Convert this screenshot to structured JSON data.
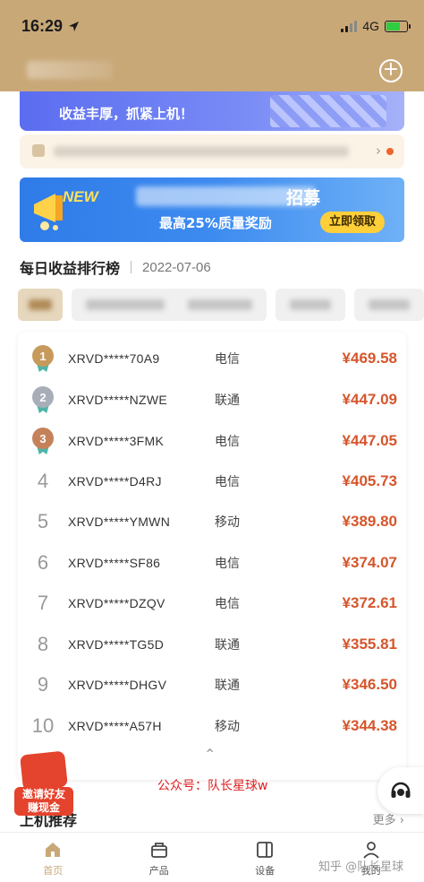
{
  "status_bar": {
    "time": "16:29",
    "network": "4G"
  },
  "header": {
    "add_icon": "plus-circle-icon"
  },
  "banner_top": {
    "slogan": "收益丰厚，抓紧上机！"
  },
  "notice": {
    "chevron": "›"
  },
  "banner_promo": {
    "tag": "NEW",
    "title_suffix": "招募",
    "reward_text": "最高25%质量奖励",
    "cta": "立即领取"
  },
  "ranking": {
    "title": "每日收益排行榜",
    "date": "2022-07-06",
    "rows": [
      {
        "rank": "1",
        "code": "XRVD*****70A9",
        "carrier": "电信",
        "amount": "¥469.58"
      },
      {
        "rank": "2",
        "code": "XRVD*****NZWE",
        "carrier": "联通",
        "amount": "¥447.09"
      },
      {
        "rank": "3",
        "code": "XRVD*****3FMK",
        "carrier": "电信",
        "amount": "¥447.05"
      },
      {
        "rank": "4",
        "code": "XRVD*****D4RJ",
        "carrier": "电信",
        "amount": "¥405.73"
      },
      {
        "rank": "5",
        "code": "XRVD*****YMWN",
        "carrier": "移动",
        "amount": "¥389.80"
      },
      {
        "rank": "6",
        "code": "XRVD*****SF86",
        "carrier": "电信",
        "amount": "¥374.07"
      },
      {
        "rank": "7",
        "code": "XRVD*****DZQV",
        "carrier": "电信",
        "amount": "¥372.61"
      },
      {
        "rank": "8",
        "code": "XRVD*****TG5D",
        "carrier": "联通",
        "amount": "¥355.81"
      },
      {
        "rank": "9",
        "code": "XRVD*****DHGV",
        "carrier": "联通",
        "amount": "¥346.50"
      },
      {
        "rank": "10",
        "code": "XRVD*****A57H",
        "carrier": "移动",
        "amount": "¥344.38"
      }
    ],
    "collapse": "⌃"
  },
  "overlay": {
    "public_account": "公众号：队长星球w",
    "invite_line1": "邀请好友",
    "invite_line2": "赚现金",
    "recommend_title": "上机推荐",
    "more": "更多 ›",
    "zhihu": "知乎 @队长星球"
  },
  "tabbar": {
    "items": [
      {
        "label": "首页",
        "icon": "home-icon"
      },
      {
        "label": "产品",
        "icon": "box-icon"
      },
      {
        "label": "设备",
        "icon": "device-icon"
      },
      {
        "label": "我的",
        "icon": "user-icon"
      }
    ]
  },
  "colors": {
    "header": "#c9a878",
    "amount": "#d6552b",
    "accent": "#ffcf3a"
  }
}
